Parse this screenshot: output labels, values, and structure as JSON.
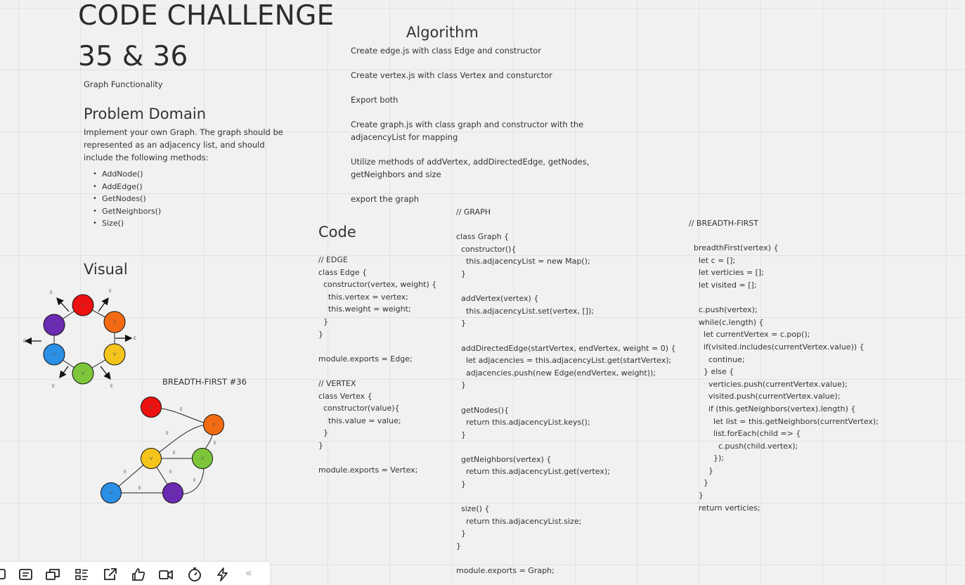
{
  "header": {
    "title_line1": "CODE CHALLENGE",
    "title_line2": "35 & 36",
    "subtitle": "Graph Functionality"
  },
  "problem": {
    "heading": "Problem Domain",
    "description": "Implement your own Graph. The graph should be represented as an adjacency list, and should include the following methods:",
    "methods": [
      "AddNode()",
      "AddEdge()",
      "GetNodes()",
      "GetNeighbors()",
      "Size()"
    ]
  },
  "visual": {
    "heading": "Visual",
    "breadth_label": "BREADTH-FIRST #36",
    "node_label": "V",
    "edge_label": "E",
    "colors": {
      "red": "#ee1111",
      "orange": "#f26b12",
      "yellow": "#f4c41c",
      "green": "#7dc63a",
      "blue": "#2b8fe6",
      "purple": "#6a2bb2"
    }
  },
  "algorithm": {
    "heading": "Algorithm",
    "steps": [
      "Create edge.js with class Edge and constructor",
      "Create vertex.js with class Vertex and consturctor",
      "Export both",
      "Create graph.js with class graph and constructor with the adjacencyList for mapping",
      "Utilize methods of addVertex, addDirectedEdge, getNodes, getNeighbors and size",
      "export the graph"
    ]
  },
  "code": {
    "heading": "Code",
    "edge_vertex_lines": [
      "// EDGE",
      "class Edge {",
      "  constructor(vertex, weight) {",
      "    this.vertex = vertex;",
      "    this.weight = weight;",
      "  }",
      "}",
      "",
      "module.exports = Edge;",
      "",
      "// VERTEX",
      "class Vertex {",
      "  constructor(value){",
      "    this.value = value;",
      "  }",
      "}",
      "",
      "module.exports = Vertex;"
    ],
    "graph_lines": [
      "// GRAPH",
      "",
      "class Graph {",
      "  constructor(){",
      "    this.adjacencyList = new Map();",
      "  }",
      "",
      "  addVertex(vertex) {",
      "    this.adjacencyList.set(vertex, []);",
      "  }",
      "",
      "  addDirectedEdge(startVertex, endVertex, weight = 0) {",
      "    let adjacencies = this.adjacencyList.get(startVertex);",
      "    adjacencies.push(new Edge(endVertex, weight));",
      "  }",
      "",
      "  getNodes(){",
      "    return this.adjacencyList.keys();",
      "  }",
      "",
      "  getNeighbors(vertex) {",
      "    return this.adjacencyList.get(vertex);",
      "  }",
      "",
      "  size() {",
      "    return this.adjacencyList.size;",
      "  }",
      "}",
      "",
      "module.exports = Graph;"
    ],
    "breadth_lines": [
      "// BREADTH-FIRST",
      "",
      "  breadthFirst(vertex) {",
      "    let c = [];",
      "    let verticies = [];",
      "    let visited = [];",
      "",
      "    c.push(vertex);",
      "    while(c.length) {",
      "      let currentVertex = c.pop();",
      "      if(visited.includes(currentVertex.value)) {",
      "        continue;",
      "      } else {",
      "        verticies.push(currentVertex.value);",
      "        visited.push(currentVertex.value);",
      "        if (this.getNeighbors(vertex).length) {",
      "          let list = this.getNeighbors(currentVertex);",
      "          list.forEach(child => {",
      "            c.push(child.vertex);",
      "          });",
      "        }",
      "      }",
      "    }",
      "    return verticies;"
    ]
  },
  "toolbar": {
    "icons": [
      "frame-icon",
      "notes-icon",
      "card-icon",
      "list-icon",
      "export-icon",
      "thumbs-up-icon",
      "video-icon",
      "timer-icon",
      "lightning-icon",
      "collapse-icon"
    ],
    "collapse_glyph": "«"
  }
}
